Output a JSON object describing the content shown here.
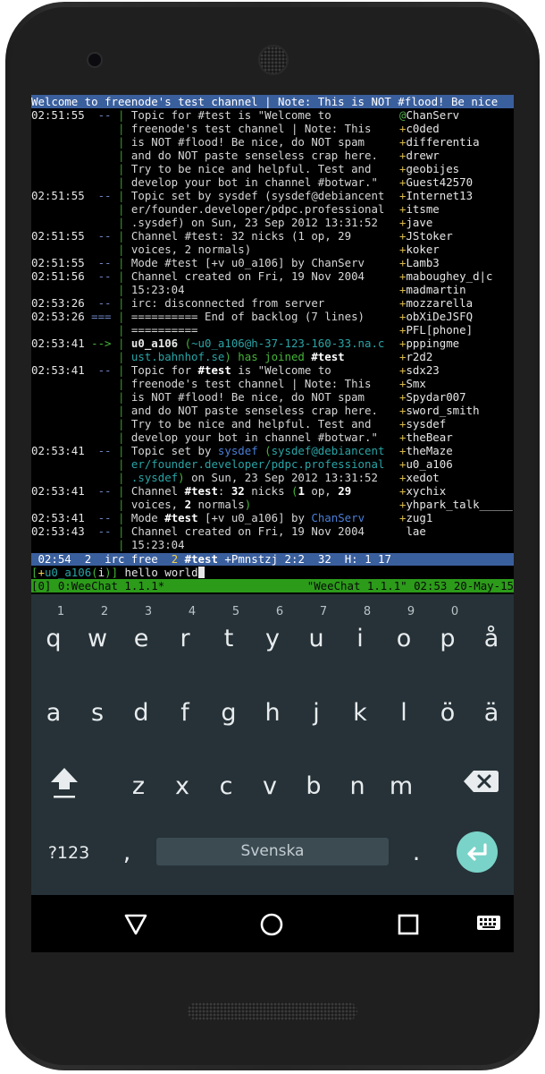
{
  "terminal": {
    "title": "Welcome to freenode's test channel | Note: This is NOT #flood! Be nice",
    "status": {
      "time": "02:54",
      "num": "2",
      "server": "irc free",
      "buffer_num": "2",
      "channel": "#test",
      "modes": "+Pmnstzj 2:2",
      "nick_count": "32",
      "hotlist": "H: 1",
      "lag": "17"
    },
    "input": {
      "prefix_open": "[",
      "prefix_mode": "+",
      "prefix_nick": "u0_a106",
      "prefix_paren_open": "(",
      "prefix_umode": "i",
      "prefix_paren_close": ")",
      "prefix_close": "]",
      "text": "hello world"
    },
    "window_bar": {
      "left": "[0] 0:WeeChat 1.1.1*",
      "right": "\"WeeChat 1.1.1\" 02:53 20-May-15"
    },
    "nicklist": [
      {
        "mode": "@",
        "name": "ChanServ"
      },
      {
        "mode": "+",
        "name": "c0ded"
      },
      {
        "mode": "+",
        "name": "differentia"
      },
      {
        "mode": "+",
        "name": "drewr"
      },
      {
        "mode": "+",
        "name": "geobijes"
      },
      {
        "mode": "+",
        "name": "Guest42570"
      },
      {
        "mode": "+",
        "name": "Internet13"
      },
      {
        "mode": "+",
        "name": "itsme"
      },
      {
        "mode": "+",
        "name": "jave"
      },
      {
        "mode": "+",
        "name": "JStoker"
      },
      {
        "mode": "+",
        "name": "koker"
      },
      {
        "mode": "+",
        "name": "Lamb3"
      },
      {
        "mode": "+",
        "name": "maboughey_d|c"
      },
      {
        "mode": "+",
        "name": "madmartin"
      },
      {
        "mode": "+",
        "name": "mozzarella"
      },
      {
        "mode": "+",
        "name": "obXiDeJSFQ"
      },
      {
        "mode": "+",
        "name": "PFL[phone]"
      },
      {
        "mode": "+",
        "name": "pppingme"
      },
      {
        "mode": "+",
        "name": "r2d2"
      },
      {
        "mode": "+",
        "name": "sdx23"
      },
      {
        "mode": "+",
        "name": "Smx"
      },
      {
        "mode": "+",
        "name": "Spydar007"
      },
      {
        "mode": "+",
        "name": "sword_smith"
      },
      {
        "mode": "+",
        "name": "sysdef"
      },
      {
        "mode": "+",
        "name": "theBear"
      },
      {
        "mode": "+",
        "name": "theMaze"
      },
      {
        "mode": "+",
        "name": "u0_a106"
      },
      {
        "mode": "+",
        "name": "xedot"
      },
      {
        "mode": "+",
        "name": "xychix"
      },
      {
        "mode": "+",
        "name": "yhpark_talk_____"
      },
      {
        "mode": "+",
        "name": "zug1"
      },
      {
        "mode": "",
        "name": "lae"
      }
    ],
    "lines": [
      {
        "time": "02:51:55",
        "prefix": " --",
        "segs": [
          {
            "t": "Topic for #test is \"Welcome to"
          }
        ]
      },
      {
        "time": "",
        "prefix": "",
        "segs": [
          {
            "t": "freenode's test channel | Note: This"
          }
        ]
      },
      {
        "time": "",
        "prefix": "",
        "segs": [
          {
            "t": "is NOT #flood! Be nice, do NOT spam"
          }
        ]
      },
      {
        "time": "",
        "prefix": "",
        "segs": [
          {
            "t": "and do NOT paste senseless crap here."
          }
        ]
      },
      {
        "time": "",
        "prefix": "",
        "segs": [
          {
            "t": "Try to be nice and helpful. Test and"
          }
        ]
      },
      {
        "time": "",
        "prefix": "",
        "segs": [
          {
            "t": "develop your bot in channel #botwar.\""
          }
        ]
      },
      {
        "time": "02:51:55",
        "prefix": " --",
        "segs": [
          {
            "t": "Topic set by sysdef (sysdef@debiancent"
          }
        ]
      },
      {
        "time": "",
        "prefix": "",
        "segs": [
          {
            "t": "er/founder.developer/pdpc.professional"
          }
        ]
      },
      {
        "time": "",
        "prefix": "",
        "segs": [
          {
            "t": ".sysdef) on Sun, 23 Sep 2012 13:31:52"
          }
        ]
      },
      {
        "time": "02:51:55",
        "prefix": " --",
        "segs": [
          {
            "t": "Channel #test: 32 nicks (1 op, 29"
          }
        ]
      },
      {
        "time": "",
        "prefix": "",
        "segs": [
          {
            "t": "voices, 2 normals)"
          }
        ]
      },
      {
        "time": "02:51:55",
        "prefix": " --",
        "segs": [
          {
            "t": "Mode #test [+v u0_a106] by ChanServ"
          }
        ]
      },
      {
        "time": "02:51:56",
        "prefix": " --",
        "segs": [
          {
            "t": "Channel created on Fri, 19 Nov 2004"
          }
        ]
      },
      {
        "time": "",
        "prefix": "",
        "segs": [
          {
            "t": "15:23:04"
          }
        ]
      },
      {
        "time": "02:53:26",
        "prefix": " --",
        "segs": [
          {
            "t": "irc: disconnected from server"
          }
        ]
      },
      {
        "time": "02:53:26",
        "prefix": "===",
        "segs": [
          {
            "t": "========== End of backlog (7 lines)"
          }
        ]
      },
      {
        "time": "",
        "prefix": "",
        "segs": [
          {
            "t": "=========="
          }
        ]
      },
      {
        "time": "02:53:41",
        "prefix": "-->",
        "segs": [
          {
            "t": "u0_a106",
            "c": "nick-join"
          },
          {
            "t": " (",
            "c": "gr"
          },
          {
            "t": "~u0_a106@h-37-123-160-33.na.c",
            "c": "cy"
          }
        ]
      },
      {
        "time": "",
        "prefix": "",
        "segs": [
          {
            "t": "ust.bahnhof.se",
            "c": "cy"
          },
          {
            "t": ") has joined ",
            "c": "gr"
          },
          {
            "t": "#test",
            "c": "b"
          }
        ]
      },
      {
        "time": "02:53:41",
        "prefix": " --",
        "segs": [
          {
            "t": "Topic for "
          },
          {
            "t": "#test",
            "c": "b"
          },
          {
            "t": " is \"Welcome to"
          }
        ]
      },
      {
        "time": "",
        "prefix": "",
        "segs": [
          {
            "t": "freenode's test channel | Note: This"
          }
        ]
      },
      {
        "time": "",
        "prefix": "",
        "segs": [
          {
            "t": "is NOT #flood! Be nice, do NOT spam"
          }
        ]
      },
      {
        "time": "",
        "prefix": "",
        "segs": [
          {
            "t": "and do NOT paste senseless crap here."
          }
        ]
      },
      {
        "time": "",
        "prefix": "",
        "segs": [
          {
            "t": "Try to be nice and helpful. Test and"
          }
        ]
      },
      {
        "time": "",
        "prefix": "",
        "segs": [
          {
            "t": "develop your bot in channel #botwar.\""
          }
        ]
      },
      {
        "time": "02:53:41",
        "prefix": " --",
        "segs": [
          {
            "t": "Topic set by "
          },
          {
            "t": "sysdef",
            "c": "bl"
          },
          {
            "t": " (",
            "c": "gr"
          },
          {
            "t": "sysdef@debiancent",
            "c": "cy"
          }
        ]
      },
      {
        "time": "",
        "prefix": "",
        "segs": [
          {
            "t": "er/founder.developer/pdpc.professional",
            "c": "cy"
          }
        ]
      },
      {
        "time": "",
        "prefix": "",
        "segs": [
          {
            "t": ".sysdef",
            "c": "cy"
          },
          {
            "t": ")",
            "c": "gr"
          },
          {
            "t": " on Sun, 23 Sep 2012 13:31:52"
          }
        ]
      },
      {
        "time": "02:53:41",
        "prefix": " --",
        "segs": [
          {
            "t": "Channel "
          },
          {
            "t": "#test",
            "c": "b"
          },
          {
            "t": ": "
          },
          {
            "t": "32",
            "c": "b"
          },
          {
            "t": " nicks "
          },
          {
            "t": "(",
            "c": "gr"
          },
          {
            "t": "1",
            "c": "b"
          },
          {
            "t": " op, "
          },
          {
            "t": "29",
            "c": "b"
          }
        ]
      },
      {
        "time": "",
        "prefix": "",
        "segs": [
          {
            "t": "voices, "
          },
          {
            "t": "2",
            "c": "b"
          },
          {
            "t": " normals"
          },
          {
            "t": ")",
            "c": "gr"
          }
        ]
      },
      {
        "time": "02:53:41",
        "prefix": " --",
        "segs": [
          {
            "t": "Mode "
          },
          {
            "t": "#test",
            "c": "b"
          },
          {
            "t": " [+v u0_a106] by "
          },
          {
            "t": "ChanServ",
            "c": "bl"
          }
        ]
      },
      {
        "time": "02:53:43",
        "prefix": " --",
        "segs": [
          {
            "t": "Channel created on Fri, 19 Nov 2004"
          }
        ]
      },
      {
        "time": "",
        "prefix": "",
        "segs": [
          {
            "t": "15:23:04"
          }
        ]
      }
    ]
  },
  "keyboard": {
    "row1": [
      {
        "k": "q",
        "h": "1"
      },
      {
        "k": "w",
        "h": "2"
      },
      {
        "k": "e",
        "h": "3"
      },
      {
        "k": "r",
        "h": "4"
      },
      {
        "k": "t",
        "h": "5"
      },
      {
        "k": "y",
        "h": "6"
      },
      {
        "k": "u",
        "h": "7"
      },
      {
        "k": "i",
        "h": "8"
      },
      {
        "k": "o",
        "h": "9"
      },
      {
        "k": "p",
        "h": "0"
      },
      {
        "k": "å",
        "h": ""
      }
    ],
    "row2": [
      {
        "k": "a"
      },
      {
        "k": "s"
      },
      {
        "k": "d"
      },
      {
        "k": "f"
      },
      {
        "k": "g"
      },
      {
        "k": "h"
      },
      {
        "k": "j"
      },
      {
        "k": "k"
      },
      {
        "k": "l"
      },
      {
        "k": "ö"
      },
      {
        "k": "ä"
      }
    ],
    "row3": [
      {
        "k": "z"
      },
      {
        "k": "x"
      },
      {
        "k": "c"
      },
      {
        "k": "v"
      },
      {
        "k": "b"
      },
      {
        "k": "n"
      },
      {
        "k": "m"
      }
    ],
    "symbols_label": "?123",
    "comma_label": ",",
    "period_label": ".",
    "space_label": "Svenska",
    "accent_color": "#7ad3c8"
  },
  "icons": {
    "shift": "shift-icon",
    "backspace": "backspace-icon",
    "enter": "enter-icon",
    "back": "back-icon",
    "home": "home-icon",
    "recents": "recents-icon",
    "keyboard": "keyboard-icon"
  }
}
